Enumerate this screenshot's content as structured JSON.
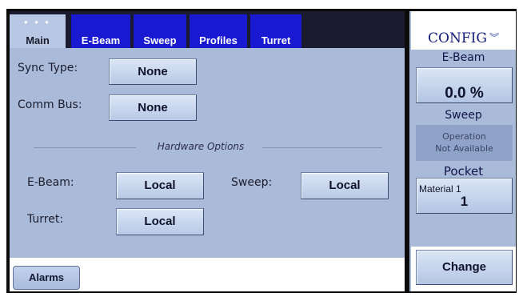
{
  "tabs": [
    {
      "label": "Main",
      "active": true
    },
    {
      "label": "E-Beam",
      "active": false
    },
    {
      "label": "Sweep",
      "active": false
    },
    {
      "label": "Profiles",
      "active": false
    },
    {
      "label": "Turret",
      "active": false
    }
  ],
  "main": {
    "sync_type_label": "Sync Type:",
    "sync_type_value": "None",
    "comm_bus_label": "Comm Bus:",
    "comm_bus_value": "None",
    "hardware_options_title": "Hardware Options",
    "ebeam_label": "E-Beam:",
    "ebeam_value": "Local",
    "sweep_label": "Sweep:",
    "sweep_value": "Local",
    "turret_label": "Turret:",
    "turret_value": "Local"
  },
  "footer": {
    "alarms_label": "Alarms"
  },
  "side": {
    "config_title": "CONFIG",
    "ebeam_title": "E-Beam",
    "ebeam_value": "0.0 %",
    "sweep_title": "Sweep",
    "sweep_status_line1": "Operation",
    "sweep_status_line2": "Not Available",
    "pocket_title": "Pocket",
    "pocket_material": "Material 1",
    "pocket_number": "1",
    "change_label": "Change"
  },
  "colors": {
    "tab_blue": "#1919d2",
    "panel_bg": "#a9bbd9",
    "config_text": "#121c7a"
  }
}
